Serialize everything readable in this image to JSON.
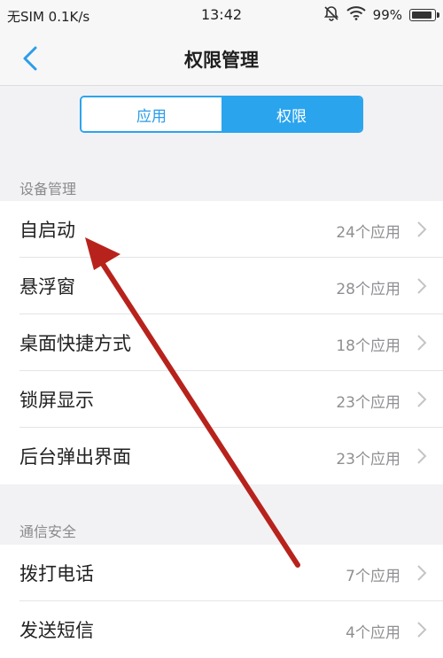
{
  "status": {
    "carrier": "无SIM",
    "speed": "0.1K/s",
    "time": "13:42",
    "battery": "99%"
  },
  "nav": {
    "title": "权限管理"
  },
  "tabs": [
    {
      "label": "应用",
      "active": false
    },
    {
      "label": "权限",
      "active": true
    }
  ],
  "sections": [
    {
      "header": "设备管理",
      "items": [
        {
          "label": "自启动",
          "count": "24个应用"
        },
        {
          "label": "悬浮窗",
          "count": "28个应用"
        },
        {
          "label": "桌面快捷方式",
          "count": "18个应用"
        },
        {
          "label": "锁屏显示",
          "count": "23个应用"
        },
        {
          "label": "后台弹出界面",
          "count": "23个应用"
        }
      ]
    },
    {
      "header": "通信安全",
      "items": [
        {
          "label": "拨打电话",
          "count": "7个应用"
        },
        {
          "label": "发送短信",
          "count": "4个应用"
        }
      ]
    }
  ],
  "colors": {
    "accent": "#2ba4ee",
    "annotation_arrow": "#b7231c"
  }
}
